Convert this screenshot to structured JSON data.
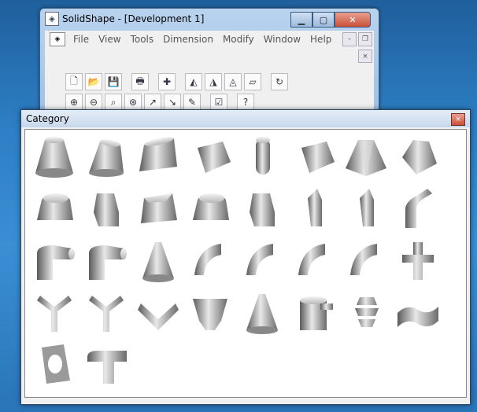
{
  "main_window": {
    "title": "SolidShape - [Development 1]",
    "menu": [
      "File",
      "View",
      "Tools",
      "Dimension",
      "Modify",
      "Window",
      "Help"
    ],
    "caption_buttons": {
      "minimize": "▁",
      "maximize": "▢",
      "close": "✕"
    },
    "mdi_buttons": {
      "minimize": "–",
      "restore": "❐",
      "close": "×"
    }
  },
  "toolbar": {
    "row1": [
      "new-icon",
      "open-icon",
      "save-icon",
      "print-icon",
      "cross-axis-icon",
      "shape-a-icon",
      "shape-b-icon",
      "shape-c-icon",
      "shape-d-icon",
      "refresh-icon"
    ],
    "row2": [
      "zoom-in-icon",
      "zoom-out-icon",
      "zoom-window-icon",
      "zoom-all-icon",
      "measure-a-icon",
      "measure-b-icon",
      "measure-c-icon",
      "properties-icon",
      "help-icon"
    ],
    "glyphs": {
      "new-icon": "🗋",
      "open-icon": "📂",
      "save-icon": "💾",
      "print-icon": "🖶",
      "cross-axis-icon": "✚",
      "shape-a-icon": "◭",
      "shape-b-icon": "◮",
      "shape-c-icon": "◬",
      "shape-d-icon": "▱",
      "refresh-icon": "↻",
      "zoom-in-icon": "⊕",
      "zoom-out-icon": "⊖",
      "zoom-window-icon": "⌕",
      "zoom-all-icon": "⊛",
      "measure-a-icon": "↗",
      "measure-b-icon": "↘",
      "measure-c-icon": "✎",
      "properties-icon": "☑",
      "help-icon": "?"
    }
  },
  "category_dialog": {
    "title": "Category",
    "close": "×",
    "shapes": [
      "cone-frustum",
      "oblique-cone",
      "offset-cone",
      "perforated-cone",
      "cylinder-cut",
      "slanted-cylinder",
      "square-to-round",
      "pyramid-transition",
      "round-to-oval",
      "square-hopper",
      "rect-hopper",
      "oval-frustum",
      "oval-transition",
      "hex-transition",
      "hex-prism",
      "elbow-pipe",
      "miter-elbow",
      "rounded-elbow",
      "funnel",
      "bend-elbow",
      "segment-elbow-a",
      "segment-elbow-b",
      "tapered-elbow",
      "tee-pipe",
      "y-branch",
      "y-junction",
      "v-pipe",
      "breeches",
      "cone-branch",
      "cylinder-branch",
      "helix-screw",
      "twisted-sheet",
      "plate-hole",
      "trouser-pipe"
    ]
  }
}
